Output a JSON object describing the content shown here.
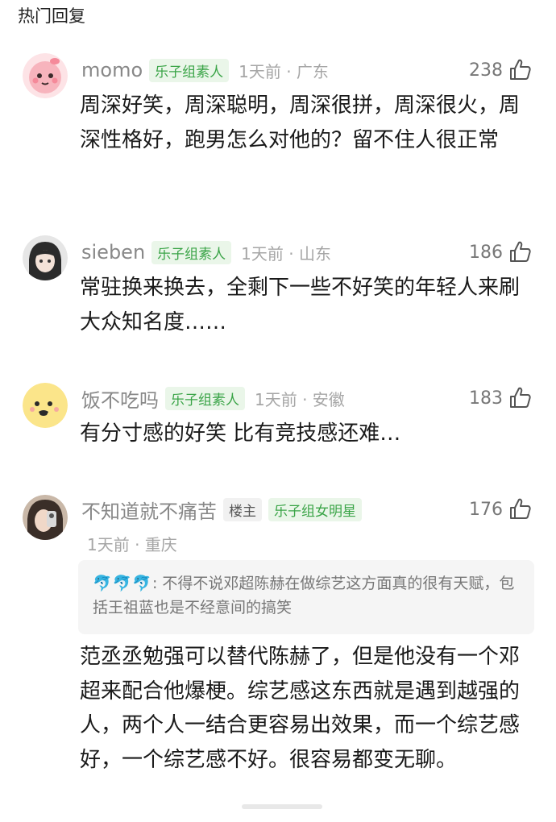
{
  "section": {
    "title": "热门回复"
  },
  "comments": [
    {
      "name": "momo",
      "badge": "乐子组素人",
      "meta": "1天前 · 广东",
      "likes": "238",
      "text": "周深好笑，周深聪明，周深很拼，周深很火，周深性格好，跑男怎么对他的？留不住人很正常"
    },
    {
      "name": "sieben",
      "badge": "乐子组素人",
      "meta": "1天前 · 山东",
      "likes": "186",
      "text": "常驻换来换去，全剩下一些不好笑的年轻人来刷大众知名度……"
    },
    {
      "name": "饭不吃吗",
      "badge": "乐子组素人",
      "meta": "1天前 · 安徽",
      "likes": "183",
      "text": "有分寸感的好笑 比有竞技感还难…"
    },
    {
      "name": "不知道就不痛苦",
      "owner_badge": "楼主",
      "badge": "乐子组女明星",
      "meta": "1天前 · 重庆",
      "likes": "176",
      "quote_emoji": "🐬🐬🐬",
      "quote_text": ": 不得不说邓超陈赫在做综艺这方面真的很有天赋，包括王祖蓝也是不经意间的搞笑",
      "text": "范丞丞勉强可以替代陈赫了，但是他没有一个邓超来配合他爆梗。综艺感这东西就是遇到越强的人，两个人一结合更容易出效果，而一个综艺感好，一个综艺感不好。很容易都变无聊。"
    }
  ],
  "colors": {
    "badge_green": "#3aa447",
    "badge_bg": "#eaf6e9",
    "meta_gray": "#a6a6a6"
  },
  "icons": {
    "like": "thumbs-up-outline-icon"
  }
}
